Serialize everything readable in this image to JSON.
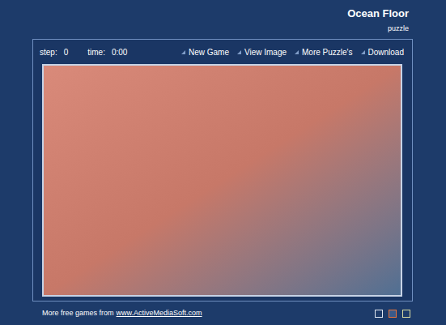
{
  "header": {
    "title": "Ocean Floor",
    "subtitle": "puzzle"
  },
  "stats": [
    {
      "label": "step:",
      "value": "0"
    },
    {
      "label": "time:",
      "value": "0:00"
    }
  ],
  "menu": [
    "New Game",
    "View Image",
    "More Puzzle's",
    "Download"
  ],
  "footer": {
    "text": "More free games from",
    "link": "www.ActiveMediaSoft.com"
  },
  "swatches": [
    {
      "selected": false,
      "color": "#dfe6f0"
    },
    {
      "selected": true,
      "color": "#e8743b"
    },
    {
      "selected": false,
      "color": "#d9dba0"
    }
  ]
}
